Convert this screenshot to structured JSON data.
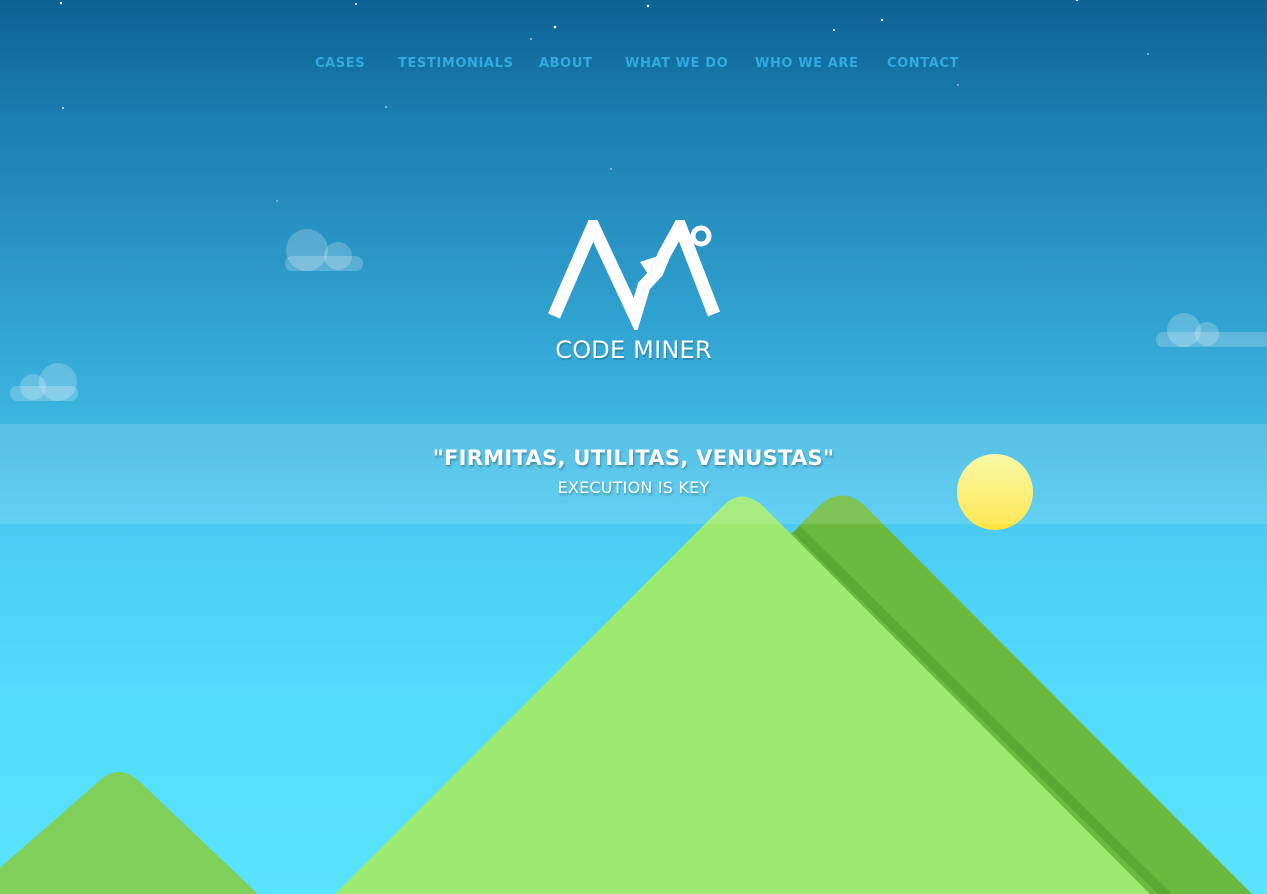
{
  "nav": {
    "items": [
      {
        "label": "CASES"
      },
      {
        "label": "TESTIMONIALS"
      },
      {
        "label": "ABOUT"
      },
      {
        "label": "WHAT WE DO"
      },
      {
        "label": "WHO WE ARE"
      },
      {
        "label": "CONTACT"
      }
    ]
  },
  "brand": {
    "name": "CODE MINER",
    "logo_icon": "mountain-peak-degree-icon"
  },
  "hero": {
    "motto": "\"FIRMITAS, UTILITAS, VENUSTAS\"",
    "tagline": "EXECUTION IS KEY"
  },
  "colors": {
    "nav_link": "#31a9e2",
    "sky_top": "#0d6293",
    "sky_bottom": "#58e3ff",
    "sun": "#fdf27a",
    "mountain_light": "#9ceb70",
    "mountain_dark": "#6aba3f",
    "hill_small": "#7fcf5a"
  }
}
